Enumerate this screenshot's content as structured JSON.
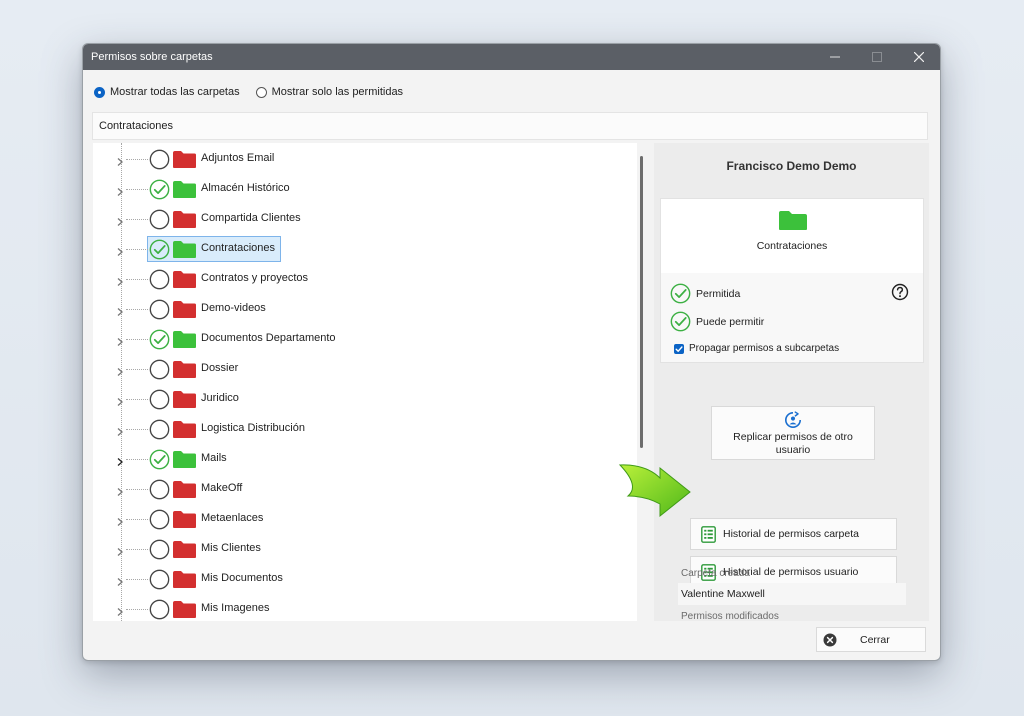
{
  "window": {
    "title": "Permisos sobre carpetas"
  },
  "filters": {
    "show_all": "Mostrar todas las carpetas",
    "show_allowed": "Mostrar solo las permitidas",
    "selected": "show_all"
  },
  "path": "Contrataciones",
  "tree": [
    {
      "label": "Adjuntos Email",
      "checked": false,
      "folder_color": "#d32f2f"
    },
    {
      "label": "Almacén Histórico",
      "checked": true,
      "folder_color": "#3cc13b"
    },
    {
      "label": "Compartida Clientes",
      "checked": false,
      "folder_color": "#d32f2f"
    },
    {
      "label": "Contrataciones",
      "checked": true,
      "folder_color": "#3cc13b",
      "selected": true
    },
    {
      "label": "Contratos y proyectos",
      "checked": false,
      "folder_color": "#d32f2f"
    },
    {
      "label": "Demo-videos",
      "checked": false,
      "folder_color": "#d32f2f"
    },
    {
      "label": "Documentos Departamento",
      "checked": true,
      "folder_color": "#3cc13b"
    },
    {
      "label": "Dossier",
      "checked": false,
      "folder_color": "#d32f2f"
    },
    {
      "label": "Juridico",
      "checked": false,
      "folder_color": "#d32f2f"
    },
    {
      "label": "Logistica Distribución",
      "checked": false,
      "folder_color": "#d32f2f"
    },
    {
      "label": "Mails",
      "checked": true,
      "folder_color": "#3cc13b"
    },
    {
      "label": "MakeOff",
      "checked": false,
      "folder_color": "#d32f2f"
    },
    {
      "label": "Metaenlaces",
      "checked": false,
      "folder_color": "#d32f2f"
    },
    {
      "label": "Mis Clientes",
      "checked": false,
      "folder_color": "#d32f2f"
    },
    {
      "label": "Mis Documentos",
      "checked": false,
      "folder_color": "#d32f2f"
    },
    {
      "label": "Mis Imagenes",
      "checked": false,
      "folder_color": "#d32f2f"
    }
  ],
  "panel": {
    "user_name": "Francisco Demo Demo",
    "folder_name": "Contrataciones",
    "folder_color": "#3cc13b",
    "allowed_label": "Permitida",
    "can_grant_label": "Puede permitir",
    "propagate_label": "Propagar permisos a subcarpetas",
    "propagate_checked": true,
    "replicate_label": "Replicar permisos de otro usuario",
    "history_folder_label": "Historial de permisos carpeta",
    "history_user_label": "Historial de permisos usuario",
    "created_label": "Carpeta creada",
    "created_value": "Valentine Maxwell",
    "modified_label": "Permisos modificados"
  },
  "close_label": "Cerrar",
  "colors": {
    "accent": "#0b63c5",
    "check_green": "#3cb043",
    "arrow_green": "#6ccc1f"
  }
}
